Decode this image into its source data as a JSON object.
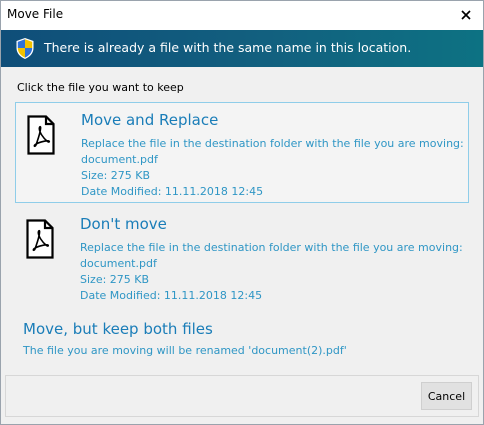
{
  "window": {
    "title": "Move File"
  },
  "banner": {
    "message": "There is already a file with the same name in this location."
  },
  "instruction": "Click the file you want to keep",
  "options": [
    {
      "title": "Move and Replace",
      "description": "Replace the file in the destination folder with the file you are moving:",
      "filename": "document.pdf",
      "size": "Size: 275 KB",
      "date_modified": "Date Modified: 11.11.2018 12:45",
      "selected": true
    },
    {
      "title": "Don't move",
      "description": "Replace the file in the destination folder with the file you are moving:",
      "filename": "document.pdf",
      "size": "Size: 275 KB",
      "date_modified": "Date Modified: 11.11.2018 12:45",
      "selected": false
    }
  ],
  "keep_both": {
    "title": "Move, but keep both files",
    "description": "The file you are moving will be renamed 'document(2).pdf'"
  },
  "footer": {
    "cancel_label": "Cancel"
  },
  "icons": {
    "close": "close-icon",
    "shield": "uac-shield-icon",
    "file": "pdf-file-icon"
  },
  "colors": {
    "link_blue": "#1a7db8",
    "detail_blue": "#2f96c5",
    "banner_start": "#0f4e79",
    "banner_end": "#0d7283",
    "selected_border": "#8fcde9"
  }
}
